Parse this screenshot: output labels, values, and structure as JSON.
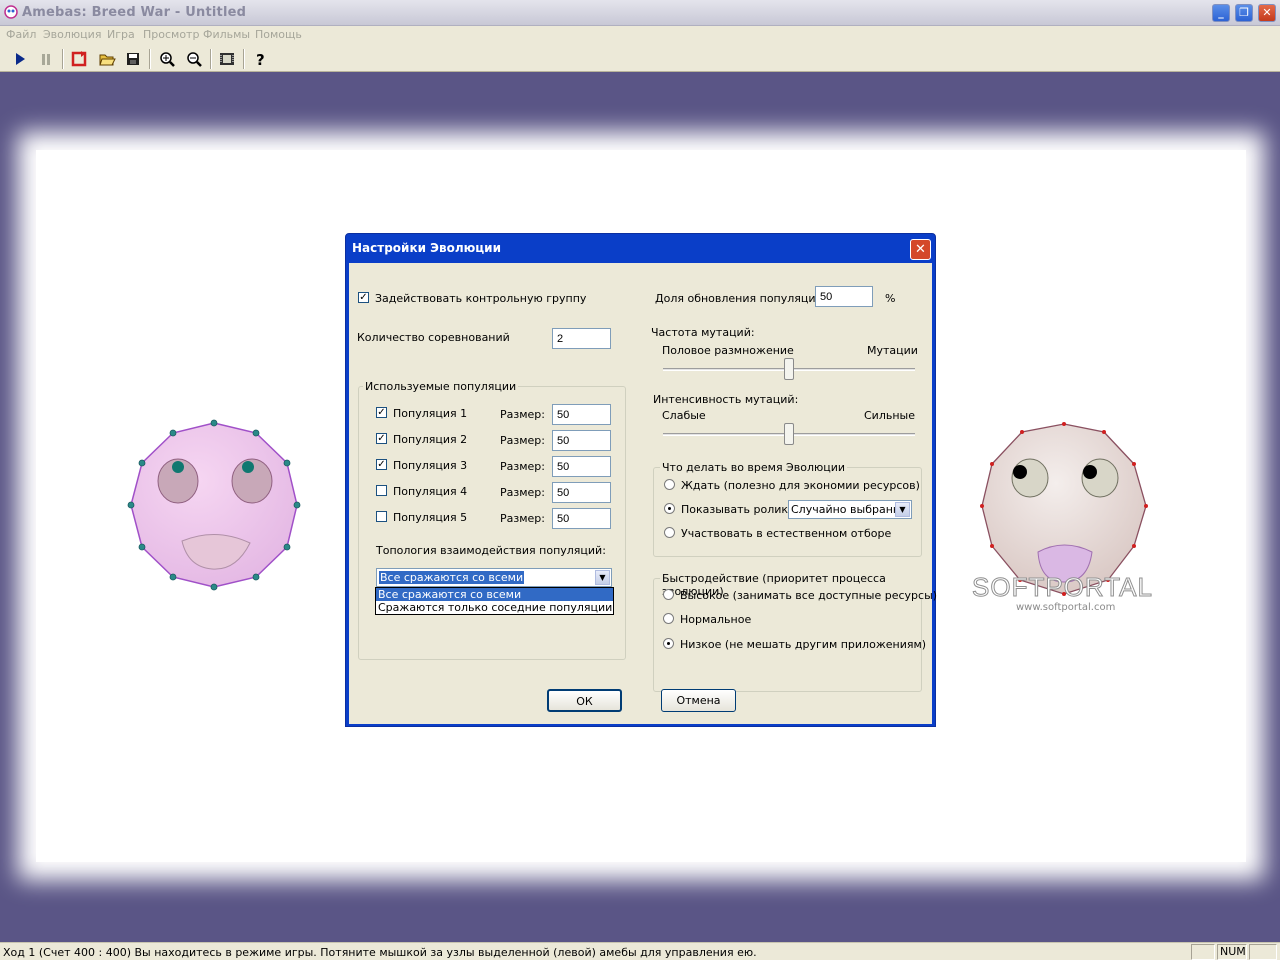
{
  "window": {
    "title": "Amebas: Breed War - Untitled"
  },
  "menu": [
    "Файл",
    "Эволюция",
    "Игра",
    "Просмотр",
    "Фильмы",
    "Помощь"
  ],
  "toolbar": [
    "play-icon",
    "pause-icon",
    "restart-icon",
    "open-folder-icon",
    "save-icon",
    "zoom-in-icon",
    "zoom-out-icon",
    "film-icon",
    "help-icon"
  ],
  "colors": {
    "workspace": "#5a5586",
    "dialog_title": "#0a3ec8",
    "selection": "#316ac5"
  },
  "dialog": {
    "title": "Настройки Эволюции",
    "close": "✕",
    "control_group": {
      "label": "Задействовать контрольную группу",
      "checked": true
    },
    "competitions": {
      "label": "Количество соревнований",
      "value": "2"
    },
    "populations_group": "Используемые популяции",
    "populations": [
      {
        "label": "Популяция 1",
        "checked": true,
        "size_label": "Размер:",
        "size": "50"
      },
      {
        "label": "Популяция 2",
        "checked": true,
        "size_label": "Размер:",
        "size": "50"
      },
      {
        "label": "Популяция 3",
        "checked": true,
        "size_label": "Размер:",
        "size": "50"
      },
      {
        "label": "Популяция 4",
        "checked": false,
        "size_label": "Размер:",
        "size": "50"
      },
      {
        "label": "Популяция 5",
        "checked": false,
        "size_label": "Размер:",
        "size": "50"
      }
    ],
    "topology": {
      "label": "Топология взаимодействия популяций:",
      "selected": "Все сражаются со всеми",
      "options": [
        "Все сражаются со всеми",
        "Сражаются только соседние популяции"
      ]
    },
    "update_share": {
      "label": "Доля обновления популяций",
      "value": "50",
      "unit": "%"
    },
    "mutation_freq": {
      "label": "Частота мутаций:",
      "left": "Половое размножение",
      "right": "Мутации",
      "value": 0.5
    },
    "mutation_intensity": {
      "label": "Интенсивность мутаций:",
      "left": "Слабые",
      "right": "Сильные",
      "value": 0.5
    },
    "during_evolution": {
      "label": "Что делать во время Эволюции",
      "options": [
        "Ждать (полезно для экономии ресурсов)",
        "Показывать ролики",
        "Участвовать в естественном отборе"
      ],
      "selected": 1,
      "clips_select": "Случайно выбранны"
    },
    "performance": {
      "label": "Быстродействие (приоритет процесса эволюции)",
      "options": [
        "Высокое (занимать все доступные ресурсы)",
        "Нормальное",
        "Низкое (не мешать другим приложениям)"
      ],
      "selected": 2
    },
    "ok": "ОК",
    "cancel": "Отмена"
  },
  "watermark": {
    "logo": "SOFTPORTAL",
    "url": "www.softportal.com"
  },
  "status": {
    "text": "Ход 1  (Счет 400 : 400)  Вы находитесь в режиме игры. Потяните мышкой за узлы выделенной (левой) амебы для управления ею.",
    "num": "NUM"
  }
}
